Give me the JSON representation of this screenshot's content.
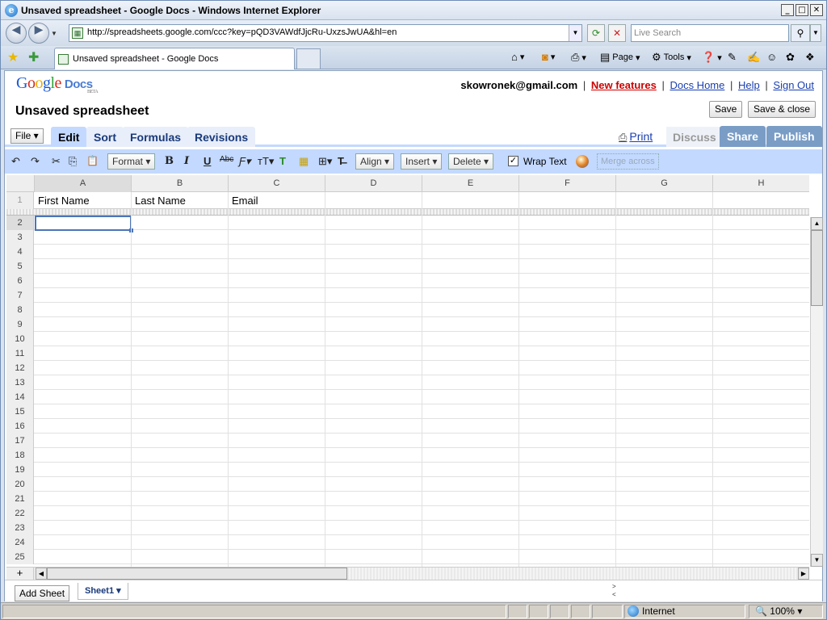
{
  "window": {
    "title": "Unsaved spreadsheet - Google Docs - Windows Internet Explorer",
    "controls": [
      "_",
      "□",
      "✕"
    ]
  },
  "browser": {
    "back_glyph": "◀",
    "forward_glyph": "▶",
    "url": "http://spreadsheets.google.com/ccc?key=pQD3VAWdfJjcRu-UxzsJwUA&hl=en",
    "search_placeholder": "Live Search",
    "tab_title": "Unsaved spreadsheet - Google Docs",
    "commands": {
      "page": "Page",
      "tools": "Tools"
    }
  },
  "app": {
    "logo": {
      "google": [
        "G",
        "o",
        "o",
        "g",
        "l",
        "e"
      ],
      "docs": "Docs",
      "beta": "BETA"
    },
    "user_email": "skowronek@gmail.com",
    "links": {
      "new_features": "New features",
      "docs_home": "Docs Home",
      "help": "Help",
      "sign_out": "Sign Out",
      "sep": "|"
    },
    "doc_title": "Unsaved spreadsheet",
    "save_label": "Save",
    "save_close_label": "Save & close"
  },
  "tabs": {
    "file": "File ▾",
    "items": [
      "Edit",
      "Sort",
      "Formulas",
      "Revisions"
    ],
    "active": "Edit",
    "print": "Print",
    "discuss": "Discuss",
    "share": "Share",
    "publish": "Publish"
  },
  "toolbar": {
    "undo": "↶",
    "redo": "↷",
    "cut": "✂",
    "copy": "⎘",
    "paste": "📋",
    "format": "Format ▾",
    "bold": "B",
    "italic": "I",
    "underline": "U",
    "strike": "Abc",
    "font": "Ƒ▾",
    "size": "тT▾",
    "text_color": "T",
    "bg_color": "▦",
    "borders": "⊞▾",
    "clear": "T̶",
    "align": "Align ▾",
    "insert": "Insert ▾",
    "delete": "Delete ▾",
    "wrap_checked": "✓",
    "wrap_text": "Wrap Text",
    "merge_across": "Merge across"
  },
  "grid": {
    "columns": [
      "A",
      "B",
      "C",
      "D",
      "E",
      "F",
      "G",
      "H"
    ],
    "frozen_row": {
      "number": "1",
      "cells": [
        "First Name",
        "Last Name",
        "Email",
        "",
        "",
        "",
        "",
        ""
      ]
    },
    "row_numbers": [
      "2",
      "3",
      "4",
      "5",
      "6",
      "7",
      "8",
      "9",
      "10",
      "11",
      "12",
      "13",
      "14",
      "15",
      "16",
      "17",
      "18",
      "19",
      "20",
      "21",
      "22",
      "23",
      "24",
      "25"
    ],
    "selected_cell": "A2",
    "add_row_glyph": "+"
  },
  "sheets": {
    "add_label": "Add Sheet",
    "tabs": [
      "Sheet1 ▾"
    ]
  },
  "statusbar": {
    "zone": "Internet",
    "zoom": "100%"
  }
}
